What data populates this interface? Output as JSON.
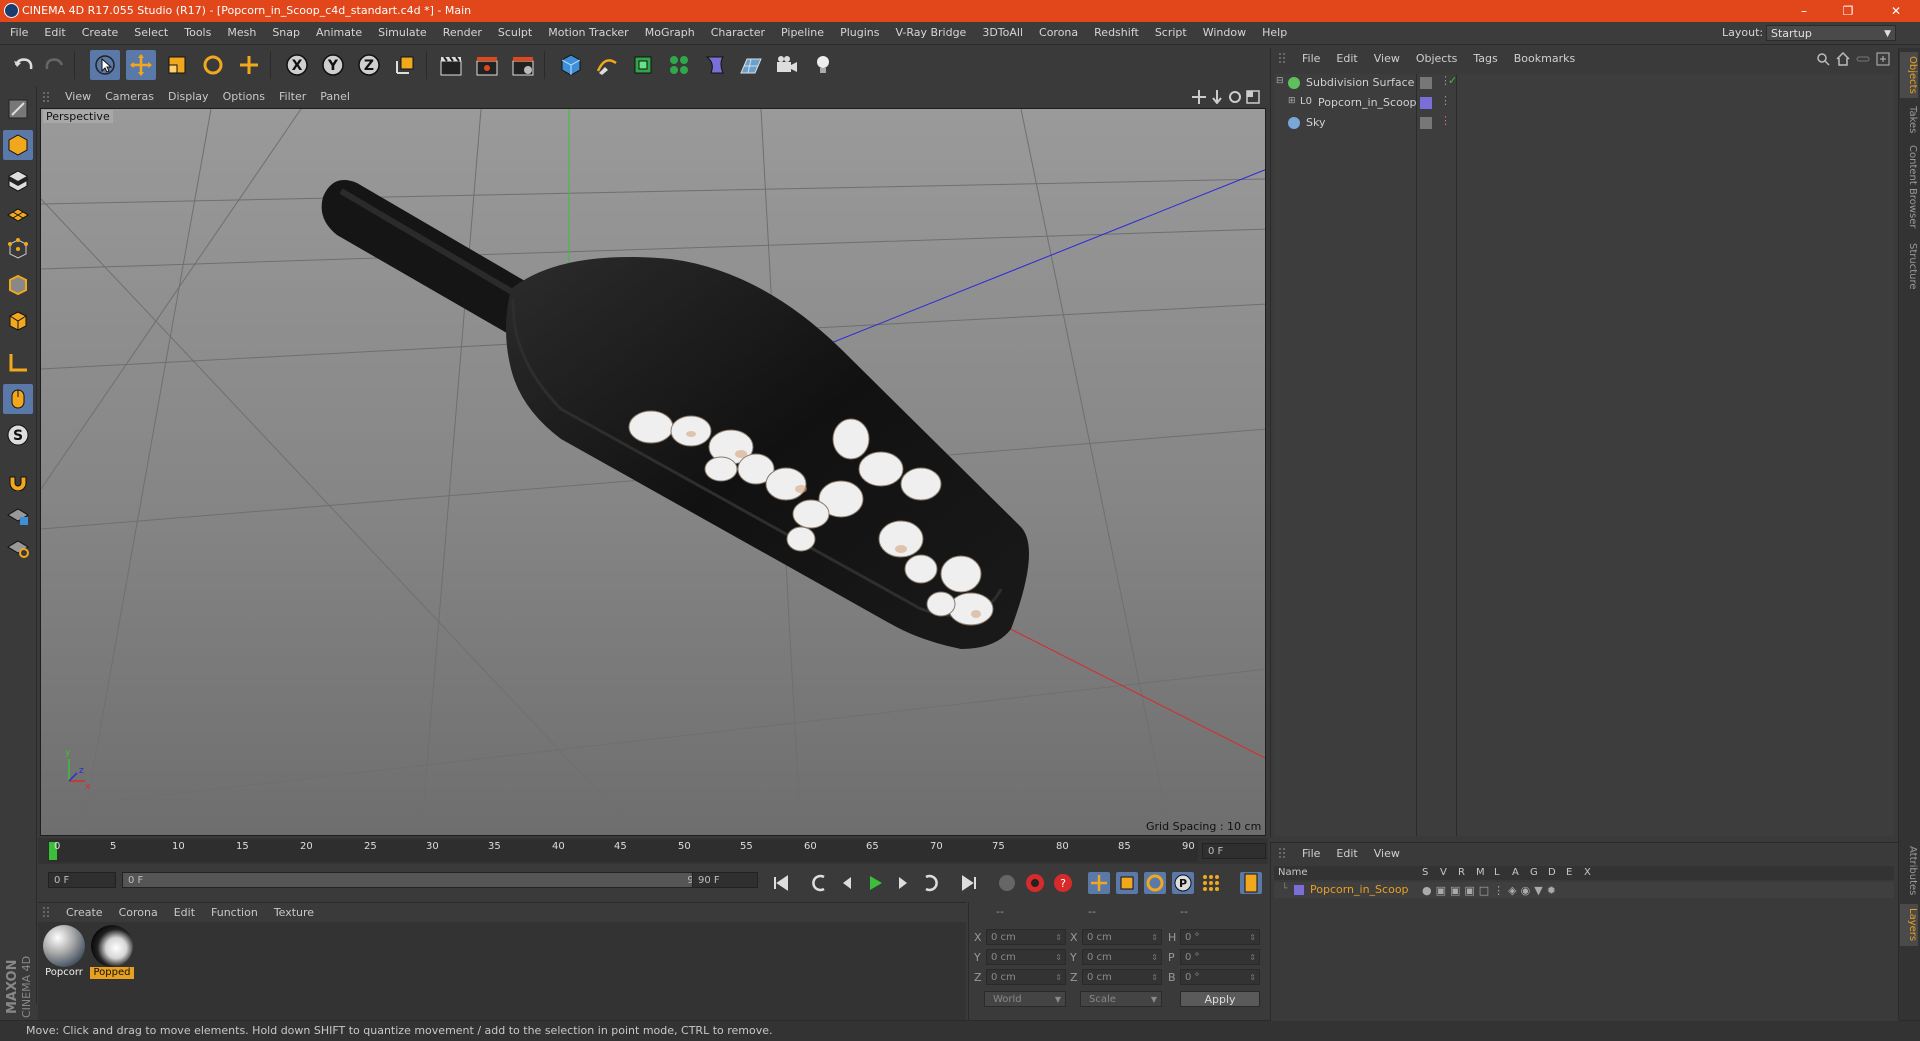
{
  "window": {
    "title": "CINEMA 4D R17.055 Studio (R17) - [Popcorn_in_Scoop_c4d_standart.c4d *] - Main",
    "controls": [
      "–",
      "❐",
      "✕"
    ]
  },
  "menubar": {
    "items": [
      "File",
      "Edit",
      "Create",
      "Select",
      "Tools",
      "Mesh",
      "Snap",
      "Animate",
      "Simulate",
      "Render",
      "Sculpt",
      "Motion Tracker",
      "MoGraph",
      "Character",
      "Pipeline",
      "Plugins",
      "V-Ray Bridge",
      "3DToAll",
      "Corona",
      "Redshift",
      "Script",
      "Window",
      "Help"
    ],
    "layout_label": "Layout:",
    "layout_value": "Startup"
  },
  "toolbar": {
    "axis_labels": [
      "X",
      "Y",
      "Z"
    ]
  },
  "viewport": {
    "menu": [
      "View",
      "Cameras",
      "Display",
      "Options",
      "Filter",
      "Panel"
    ],
    "label": "Perspective",
    "grid_spacing": "Grid Spacing : 10 cm"
  },
  "timeline": {
    "ticks": [
      "0",
      "5",
      "10",
      "15",
      "20",
      "25",
      "30",
      "35",
      "40",
      "45",
      "50",
      "55",
      "60",
      "65",
      "70",
      "75",
      "80",
      "85",
      "90"
    ],
    "current_frame_right": "0 F",
    "start_field": "0 F",
    "range_start": "0 F",
    "range_end": "90 F",
    "end_field": "90 F"
  },
  "material_manager": {
    "menu": [
      "Create",
      "Corona",
      "Edit",
      "Function",
      "Texture"
    ],
    "materials": [
      {
        "name": "Popcorr",
        "selected": false
      },
      {
        "name": "Popped",
        "selected": true
      }
    ]
  },
  "coordinates": {
    "headers": [
      "--",
      "--",
      "--"
    ],
    "rows": [
      {
        "a_label": "X",
        "a_val": "0 cm",
        "b_label": "X",
        "b_val": "0 cm",
        "c_label": "H",
        "c_val": "0 °"
      },
      {
        "a_label": "Y",
        "a_val": "0 cm",
        "b_label": "Y",
        "b_val": "0 cm",
        "c_label": "P",
        "c_val": "0 °"
      },
      {
        "a_label": "Z",
        "a_val": "0 cm",
        "b_label": "Z",
        "b_val": "0 cm",
        "c_label": "B",
        "c_val": "0 °"
      }
    ],
    "space_select": "World",
    "mode_select": "Scale",
    "apply": "Apply"
  },
  "object_manager": {
    "menu": [
      "File",
      "Edit",
      "View",
      "Objects",
      "Tags",
      "Bookmarks"
    ],
    "objects": [
      {
        "name": "Subdivision Surface",
        "icon_color": "#5fbf5f"
      },
      {
        "name": "Popcorn_in_Scoop",
        "icon_color": "#cfcfcf"
      },
      {
        "name": "Sky",
        "icon_color": "#7aa6d8"
      }
    ]
  },
  "layer_manager": {
    "menu": [
      "File",
      "Edit",
      "View"
    ],
    "columns": [
      "Name",
      "S",
      "V",
      "R",
      "M",
      "L",
      "A",
      "G",
      "D",
      "E",
      "X"
    ],
    "layers": [
      {
        "name": "Popcorn_in_Scoop",
        "color": "#7a6fd8"
      }
    ]
  },
  "right_tabs": [
    "Objects",
    "Takes",
    "Content Browser",
    "Structure",
    "Attributes",
    "Layers"
  ],
  "status": {
    "text": "Move: Click and drag to move elements. Hold down SHIFT to quantize movement / add to the selection in point mode, CTRL to remove."
  },
  "logo": {
    "text_top": "MAXON",
    "text_bottom": "CINEMA 4D"
  },
  "colors": {
    "title_bar": "#e2461b",
    "selected": "#5a78a8",
    "accent_orange": "#e8a020"
  }
}
